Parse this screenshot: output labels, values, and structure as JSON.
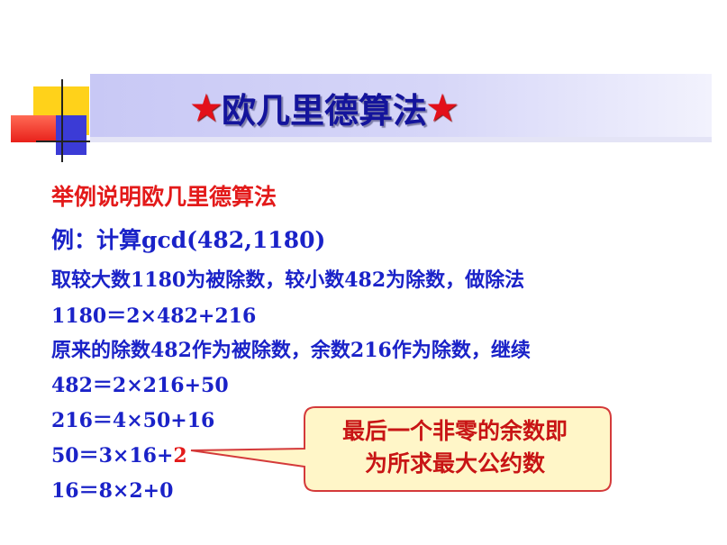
{
  "title": {
    "star_left": "★",
    "text": "欧几里德算法",
    "star_right": "★"
  },
  "lines": {
    "heading": "举例说明欧几里德算法",
    "example": "例：计算gcd(482,1180)",
    "l1": "取较大数1180为被除数，较小数482为除数，做除法",
    "l2": "1180＝2×482+216",
    "l3": "原来的除数482作为被除数，余数216作为除数，继续",
    "l4": "482＝2×216+50",
    "l5": "216＝4×50+16",
    "l6_prefix": "50＝3×16+",
    "l6_remainder": "2",
    "l7": "16＝8×2+0"
  },
  "callout": {
    "line1": "最后一个非零的余数即",
    "line2": "为所求最大公约数"
  },
  "colors": {
    "title": "#14149c",
    "body_text": "#1a22c8",
    "highlight": "#e31a1a",
    "callout_fill": "#fff6c8",
    "callout_border": "#d43a3a"
  }
}
